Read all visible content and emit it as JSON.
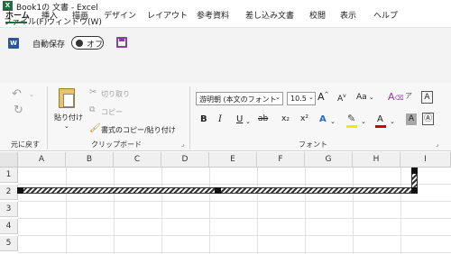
{
  "window": {
    "title": "Book1の 文書 - Excel",
    "app_icon": "excel-icon"
  },
  "menubar": {
    "items": [
      "ファイル(F)",
      "ウィンドウ(W)"
    ]
  },
  "qat": {
    "word_icon": "W",
    "autosave_label": "自動保存",
    "toggle_state": "オフ"
  },
  "tabs": {
    "items": [
      "ホーム",
      "挿入",
      "描画",
      "デザイン",
      "レイアウト",
      "参考資料",
      "差し込み文書",
      "校閲",
      "表示",
      "ヘルプ"
    ],
    "active": "ホーム"
  },
  "ribbon": {
    "undo_group": {
      "label": "元に戻す"
    },
    "clipboard": {
      "paste_label": "貼り付け",
      "cut_label": "切り取り",
      "copy_label": "コピー",
      "format_painter_label": "書式のコピー/貼り付け",
      "group_label": "クリップボード"
    },
    "font": {
      "font_name": "游明朝 (本文のフォント",
      "font_size": "10.5",
      "grow": "A",
      "shrink": "A",
      "case": "Aa",
      "bold": "B",
      "italic": "I",
      "underline": "U",
      "strike": "ab",
      "subscript": "x₂",
      "superscript": "x²",
      "text_effects": "A",
      "font_color": "A",
      "char_shade": "A",
      "group_label": "フォント"
    }
  },
  "sheet": {
    "columns": [
      "A",
      "B",
      "C",
      "D",
      "E",
      "F",
      "G",
      "H",
      "I"
    ],
    "rows": [
      "1",
      "2",
      "3",
      "4",
      "5"
    ]
  },
  "colors": {
    "accent": "#1d6f42",
    "word": "#2b579a",
    "save": "#8b3fa0",
    "highlight": "#ffe600",
    "font_red": "#d00000"
  }
}
